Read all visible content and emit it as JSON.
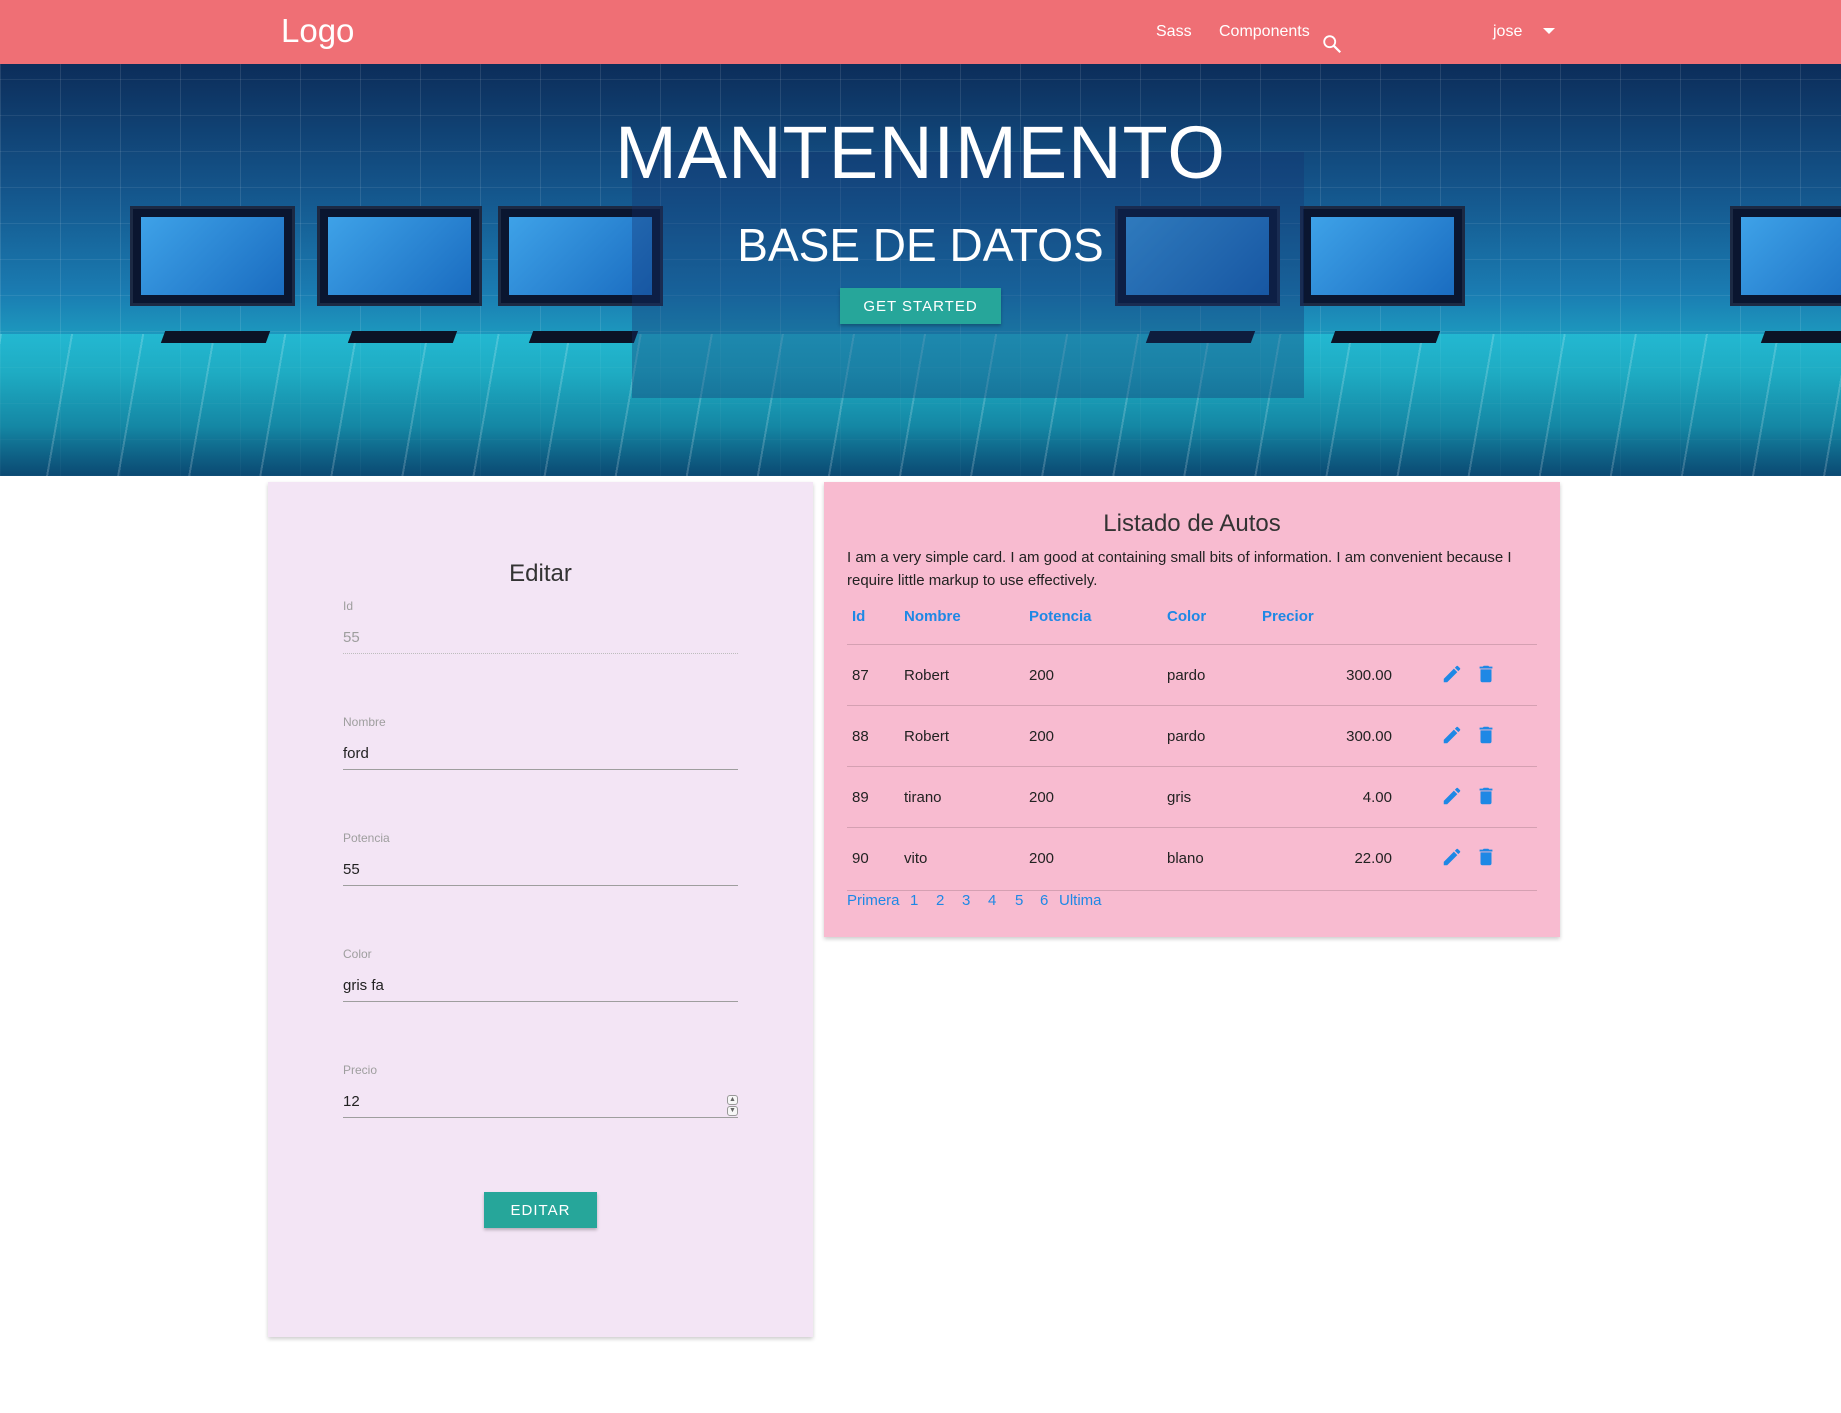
{
  "nav": {
    "logo": "Logo",
    "links": [
      "Sass",
      "Components"
    ],
    "search_icon": "search-icon",
    "user": "jose",
    "user_dropdown_icon": "caret-down-icon",
    "color": "#ef6f75"
  },
  "hero": {
    "title": "MANTENIMENTO",
    "subtitle": "BASE DE DATOS",
    "button": "GET STARTED"
  },
  "edit_form": {
    "title": "Editar",
    "fields": [
      {
        "label": "Id",
        "value": "55",
        "disabled": true
      },
      {
        "label": "Nombre",
        "value": "ford"
      },
      {
        "label": "Potencia",
        "value": "55"
      },
      {
        "label": "Color",
        "value": "gris fa"
      },
      {
        "label": "Precio",
        "value": "12",
        "type": "number"
      }
    ],
    "submit": "EDITAR",
    "background": "#f3e5f5",
    "button_color": "#26a69a"
  },
  "list": {
    "title": "Listado de Autos",
    "description": "I am a very simple card. I am good at containing small bits of information. I am convenient because I require little markup to use effectively.",
    "columns": [
      "Id",
      "Nombre",
      "Potencia",
      "Color",
      "Precior"
    ],
    "rows": [
      {
        "id": "87",
        "nombre": "Robert",
        "potencia": "200",
        "color": "pardo",
        "precio": "300.00"
      },
      {
        "id": "88",
        "nombre": "Robert",
        "potencia": "200",
        "color": "pardo",
        "precio": "300.00"
      },
      {
        "id": "89",
        "nombre": "tirano",
        "potencia": "200",
        "color": "gris",
        "precio": "4.00"
      },
      {
        "id": "90",
        "nombre": "vito",
        "potencia": "200",
        "color": "blano",
        "precio": "22.00"
      }
    ],
    "row_actions": [
      "edit-icon",
      "delete-icon"
    ],
    "pagination": [
      "Primera",
      "1",
      "2",
      "3",
      "4",
      "5",
      "6",
      "Ultima"
    ],
    "background": "#f8bbd0",
    "accent": "#1e88e5"
  }
}
